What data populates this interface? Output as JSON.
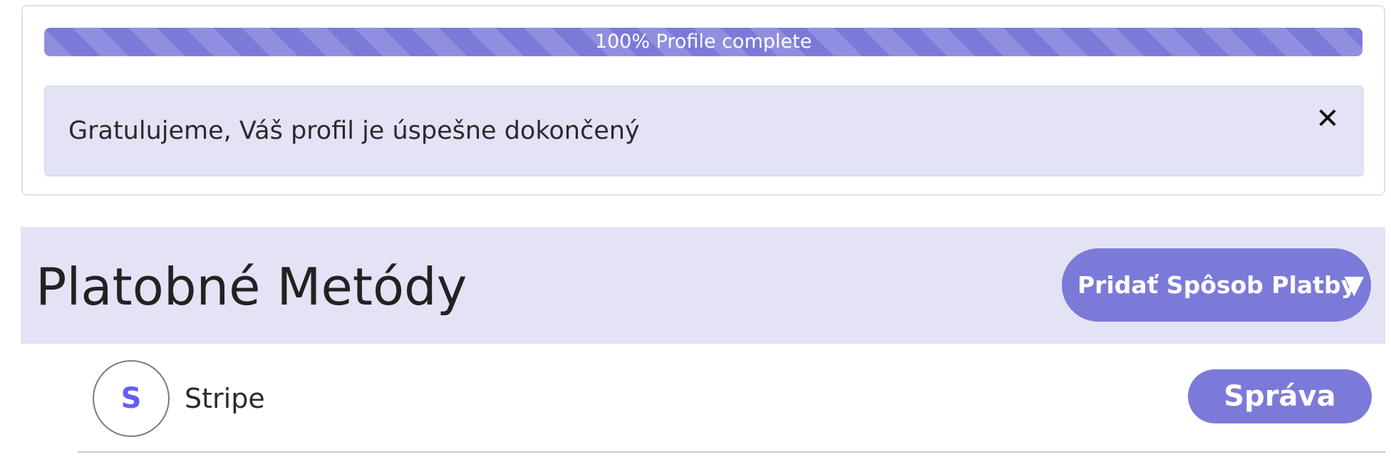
{
  "profile": {
    "progress_label": "100% Profile complete",
    "progress_percent": 100,
    "alert_message": "Gratulujeme, Váš profil je úspešne dokončený",
    "alert_close_glyph": "✕"
  },
  "payment_methods": {
    "title": "Platobné Metódy",
    "add_button_label": "Pridať Spôsob Platby",
    "add_button_caret": "▼",
    "items": [
      {
        "logo_letter": "S",
        "logo_icon": "stripe-icon",
        "name": "Stripe",
        "action_label": "Správa"
      }
    ]
  },
  "colors": {
    "accent": "#7b7ad9",
    "panel_background": "#e4e3f6",
    "stripe_brand": "#635bff"
  }
}
